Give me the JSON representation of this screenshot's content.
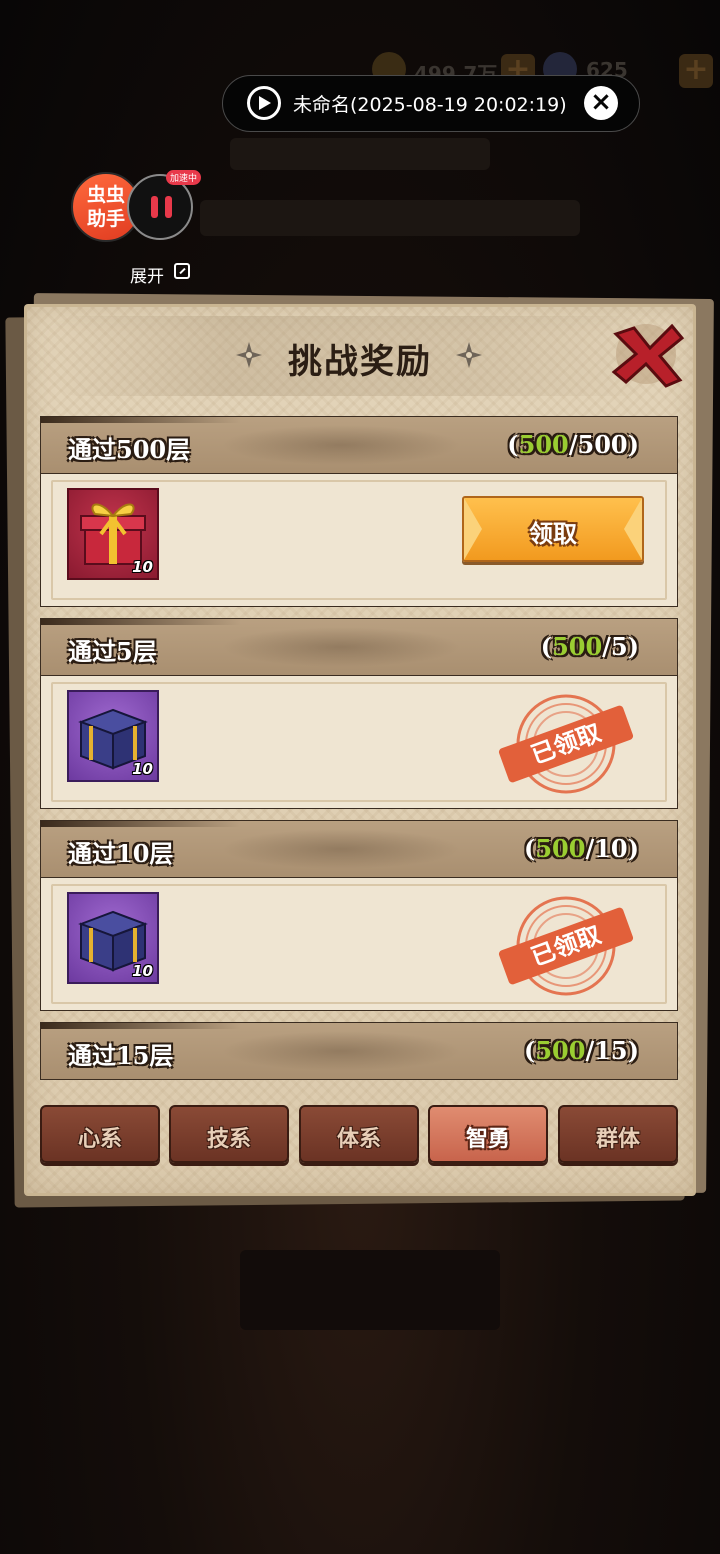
{
  "background": {
    "gold_value": "499.7万",
    "gem_value": "625"
  },
  "recording": {
    "label": "未命名(2025-08-19 20:02:19)"
  },
  "helper": {
    "logo_line1": "虫虫",
    "logo_line2": "助手",
    "badge": "加速中",
    "expand_label": "展开"
  },
  "panel": {
    "title": "挑战奖励",
    "rewards": [
      {
        "title": "通过500层",
        "current": "500",
        "total": "500",
        "count": "10",
        "box": "red-gift",
        "status": "claimable",
        "action_label": "领取"
      },
      {
        "title": "通过5层",
        "current": "500",
        "total": "5",
        "count": "10",
        "box": "purple-box",
        "status": "claimed",
        "action_label": "已领取"
      },
      {
        "title": "通过10层",
        "current": "500",
        "total": "10",
        "count": "10",
        "box": "purple-box",
        "status": "claimed",
        "action_label": "已领取"
      },
      {
        "title": "通过15层",
        "current": "500",
        "total": "15",
        "count": "",
        "box": "",
        "status": "",
        "action_label": ""
      }
    ],
    "tabs": [
      {
        "label": "心系",
        "active": false
      },
      {
        "label": "技系",
        "active": false
      },
      {
        "label": "体系",
        "active": false
      },
      {
        "label": "智勇",
        "active": true
      },
      {
        "label": "群体",
        "active": false
      }
    ]
  },
  "colors": {
    "progress_current": "#9acd32",
    "claim_button": "#f29a1f",
    "stamp": "#e2603a",
    "active_tab": "#c8644c"
  }
}
